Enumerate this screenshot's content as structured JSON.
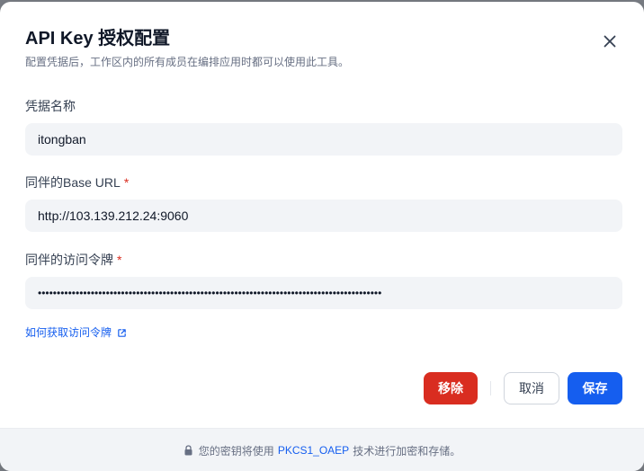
{
  "dialog": {
    "title": "API Key 授权配置",
    "subtitle": "配置凭据后，工作区内的所有成员在编排应用时都可以使用此工具。"
  },
  "fields": {
    "name": {
      "label": "凭据名称",
      "value": "itongban"
    },
    "base_url": {
      "label": "同伴的Base URL",
      "required_mark": "*",
      "value": "http://103.139.212.24:9060"
    },
    "token": {
      "label": "同伴的访问令牌",
      "required_mark": "*",
      "value": "•••••••••••••••••••••••••••••••••••••••••••••••••••••••••••••••••••••••••••••••••••••••••••"
    }
  },
  "help_link": {
    "label": "如何获取访问令牌",
    "icon": "external-link-icon"
  },
  "actions": {
    "remove_label": "移除",
    "cancel_label": "取消",
    "save_label": "保存"
  },
  "footer": {
    "icon": "lock-icon",
    "prefix": "您的密钥将使用",
    "tech": "PKCS1_OAEP",
    "suffix": "技术进行加密和存储。"
  },
  "colors": {
    "primary": "#155eef",
    "danger": "#d92d20",
    "input_bg": "#f2f4f7",
    "text": "#101828",
    "muted": "#676f83"
  }
}
